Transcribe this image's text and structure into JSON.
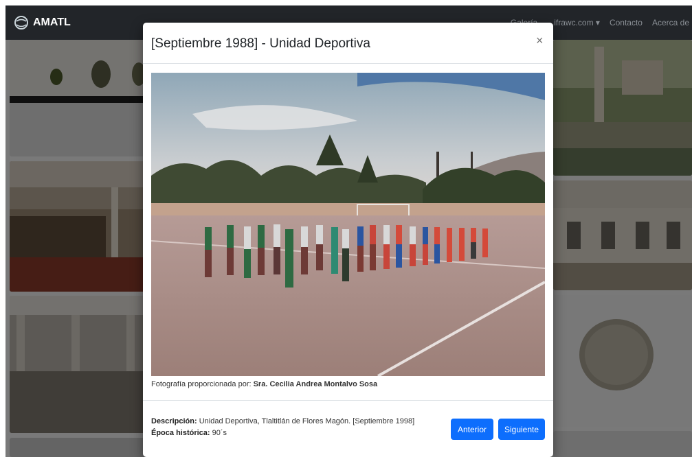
{
  "navbar": {
    "brand": "AMATL",
    "links": [
      "Galería",
      "...ifrawc.com ▾",
      "Contacto",
      "Acerca de"
    ]
  },
  "modal": {
    "title": "[Septiembre 1988] - Unidad Deportiva",
    "close_icon": "×",
    "photo_icon": "photograph-image",
    "credit_prefix": "Fotografía proporcionada por: ",
    "credit_name": "Sra. Cecilia Andrea Montalvo Sosa",
    "description_label": "Descripción:",
    "description_value": " Unidad Deportiva, Tlaltitlán de Flores Magón. [Septiembre 1998]",
    "epoch_label": "Época histórica:",
    "epoch_value": " 90´s",
    "prev_label": "Anterior",
    "next_label": "Siguiente"
  },
  "colors": {
    "navbar": "#222529",
    "primary": "#0d6efd",
    "overlay": "rgba(0,0,0,0.5)"
  }
}
